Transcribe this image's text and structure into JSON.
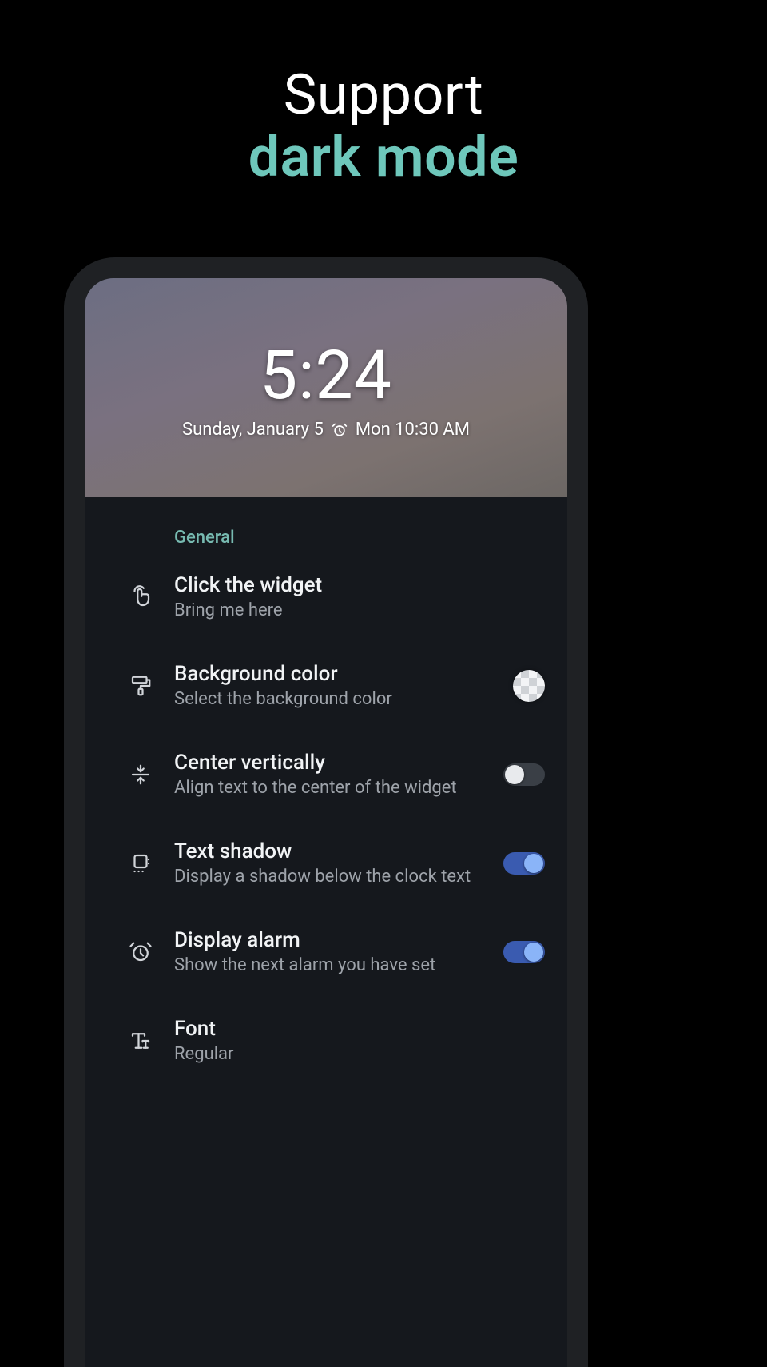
{
  "promo": {
    "line1": "Support",
    "line2": "dark mode"
  },
  "colors": {
    "accent": "#6ec7bb",
    "switch_on_track": "#3a5bb0",
    "switch_on_thumb": "#8ab4f8"
  },
  "widget": {
    "time": "5:24",
    "date": "Sunday, January 5",
    "alarm_icon": "alarm-clock-icon",
    "alarm": "Mon 10:30 AM"
  },
  "settings": {
    "section": "General",
    "items": [
      {
        "icon": "touch-icon",
        "title": "Click the widget",
        "subtitle": "Bring me here",
        "trailing": "none"
      },
      {
        "icon": "paint-roller-icon",
        "title": "Background color",
        "subtitle": "Select the background color",
        "trailing": "swatch"
      },
      {
        "icon": "center-vertical-icon",
        "title": "Center vertically",
        "subtitle": "Align text to the center of the widget",
        "trailing": "switch",
        "value": false
      },
      {
        "icon": "text-shadow-icon",
        "title": "Text shadow",
        "subtitle": "Display a shadow below the clock text",
        "trailing": "switch",
        "value": true
      },
      {
        "icon": "alarm-clock-icon",
        "title": "Display alarm",
        "subtitle": "Show the next alarm you have set",
        "trailing": "switch",
        "value": true
      },
      {
        "icon": "font-icon",
        "title": "Font",
        "subtitle": "Regular",
        "trailing": "none"
      }
    ]
  }
}
